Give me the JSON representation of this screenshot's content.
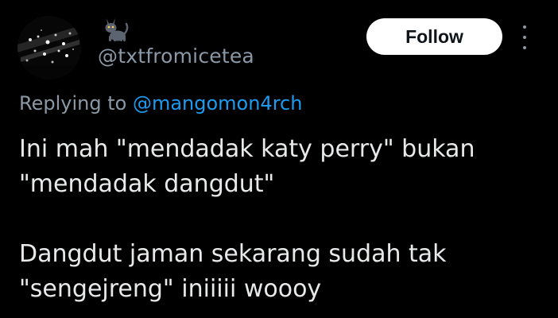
{
  "author": {
    "handle": "@txtfromicetea",
    "avatar_icon": "concert-lights-avatar",
    "name_icon": "black-cat-emoji"
  },
  "actions": {
    "follow_label": "Follow",
    "more_icon": "more-vertical-icon"
  },
  "reply": {
    "prefix": "Replying to ",
    "mention": "@mangomon4rch"
  },
  "tweet": {
    "paragraph_1_line_1": "Ini mah \"mendadak katy perry\" bukan",
    "paragraph_1_line_2": "\"mendadak dangdut\"",
    "paragraph_2_line_1": "Dangdut jaman sekarang sudah tak",
    "paragraph_2_line_2": "\"sengejreng\" iniiiii woooy"
  },
  "colors": {
    "background": "#000000",
    "text_primary": "#e7e9ea",
    "text_secondary": "#8b98a5",
    "link": "#1d9bf0",
    "follow_bg": "#ffffff",
    "follow_text": "#0f1419"
  }
}
